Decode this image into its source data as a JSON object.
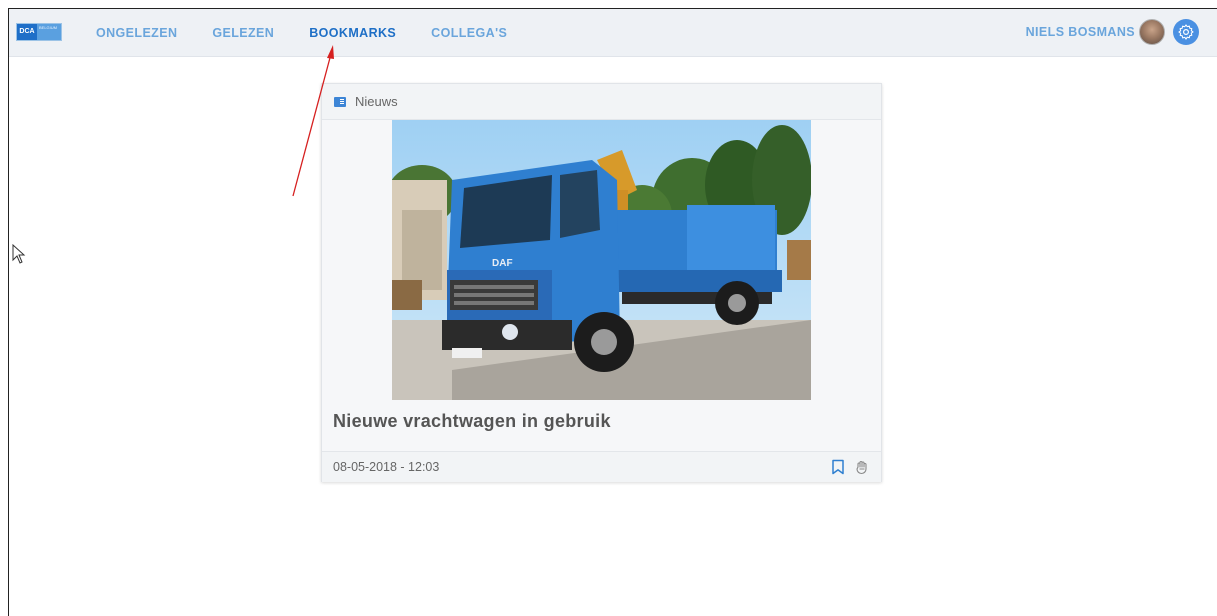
{
  "app": {
    "logo_text": "DCA",
    "logo_subtext": "BELGIUM"
  },
  "nav": {
    "items": [
      {
        "label": "ONGELEZEN"
      },
      {
        "label": "GELEZEN"
      },
      {
        "label": "BOOKMARKS"
      },
      {
        "label": "COLLEGA'S"
      }
    ],
    "active_index": 2
  },
  "user": {
    "name": "NIELS BOSMANS"
  },
  "card": {
    "category": "Nieuws",
    "title": "Nieuwe vrachtwagen in gebruik",
    "date": "08-05-2018 - 12:03",
    "image_icon": "truck-photo"
  },
  "colors": {
    "accent": "#1e6fc6",
    "nav_inactive": "#6aa5dc",
    "annotation_arrow": "#d62020"
  }
}
